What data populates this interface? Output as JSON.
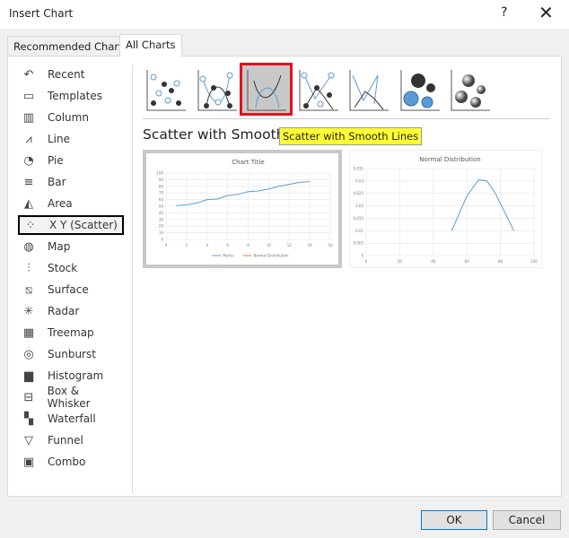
{
  "window": {
    "title": "Insert Chart",
    "help": "?",
    "close": "✕"
  },
  "tabs": [
    {
      "label": "Recommended Charts"
    },
    {
      "label": "All Charts",
      "active": true
    }
  ],
  "sidebar": {
    "items": [
      {
        "label": "Recent",
        "icon": "↶"
      },
      {
        "label": "Templates",
        "icon": "▭"
      },
      {
        "label": "Column",
        "icon": "▥"
      },
      {
        "label": "Line",
        "icon": "⩘"
      },
      {
        "label": "Pie",
        "icon": "◔"
      },
      {
        "label": "Bar",
        "icon": "≡"
      },
      {
        "label": "Area",
        "icon": "◭"
      },
      {
        "label": "X Y (Scatter)",
        "icon": "⁘",
        "selected": true
      },
      {
        "label": "Map",
        "icon": "◍"
      },
      {
        "label": "Stock",
        "icon": "⫶"
      },
      {
        "label": "Surface",
        "icon": "⧅"
      },
      {
        "label": "Radar",
        "icon": "✳"
      },
      {
        "label": "Treemap",
        "icon": "▦"
      },
      {
        "label": "Sunburst",
        "icon": "◎"
      },
      {
        "label": "Histogram",
        "icon": "▆"
      },
      {
        "label": "Box & Whisker",
        "icon": "⊟"
      },
      {
        "label": "Waterfall",
        "icon": "▚"
      },
      {
        "label": "Funnel",
        "icon": "▽"
      },
      {
        "label": "Combo",
        "icon": "▣"
      }
    ]
  },
  "subtypes": [
    "Scatter",
    "Scatter with Smooth Lines and Markers",
    "Scatter with Smooth Lines",
    "Scatter with Straight Lines and Markers",
    "Scatter with Straight Lines",
    "Bubble",
    "3-D Bubble"
  ],
  "selected_subtype_index": 2,
  "subtype_heading": "Scatter with Smooth L",
  "tooltip": "Scatter with Smooth Lines",
  "colors": {
    "series": "#5b9bd5",
    "accent": "#0078d7",
    "selection": "#e0141e",
    "tooltip": "#ffff33"
  },
  "chart_data": [
    {
      "type": "line",
      "title": "Chart Title",
      "x": [
        1,
        2,
        3,
        4,
        5,
        6,
        7,
        8,
        9,
        10,
        11,
        12,
        13,
        14
      ],
      "series": [
        {
          "name": "Marks",
          "values": [
            51,
            52,
            55,
            60,
            61,
            66,
            68,
            72,
            73,
            76,
            80,
            83,
            86,
            87
          ]
        }
      ],
      "legend": [
        "Marks",
        "Normal Distribution"
      ],
      "legend_position": "bottom",
      "xlim": [
        0,
        16
      ],
      "xticks": [
        "0",
        "2",
        "4",
        "6",
        "8",
        "10",
        "12",
        "14",
        "16"
      ],
      "ylim": [
        0,
        100
      ],
      "yticks": [
        "0",
        "10",
        "20",
        "30",
        "40",
        "50",
        "60",
        "70",
        "80",
        "90",
        "100"
      ],
      "grid": true
    },
    {
      "type": "line",
      "title": "Normal Distribution",
      "x": [
        51,
        60,
        67,
        72,
        77,
        88
      ],
      "series": [
        {
          "values": [
            0.01,
            0.024,
            0.0305,
            0.03,
            0.025,
            0.01
          ]
        }
      ],
      "xlim": [
        0,
        100
      ],
      "xticks": [
        "0",
        "20",
        "40",
        "60",
        "80",
        "100"
      ],
      "ylim": [
        0,
        0.035
      ],
      "yticks": [
        "0",
        "0.005",
        "0.01",
        "0.015",
        "0.02",
        "0.025",
        "0.03",
        "0.035"
      ],
      "grid": true
    }
  ],
  "buttons": {
    "ok": "OK",
    "cancel": "Cancel"
  }
}
